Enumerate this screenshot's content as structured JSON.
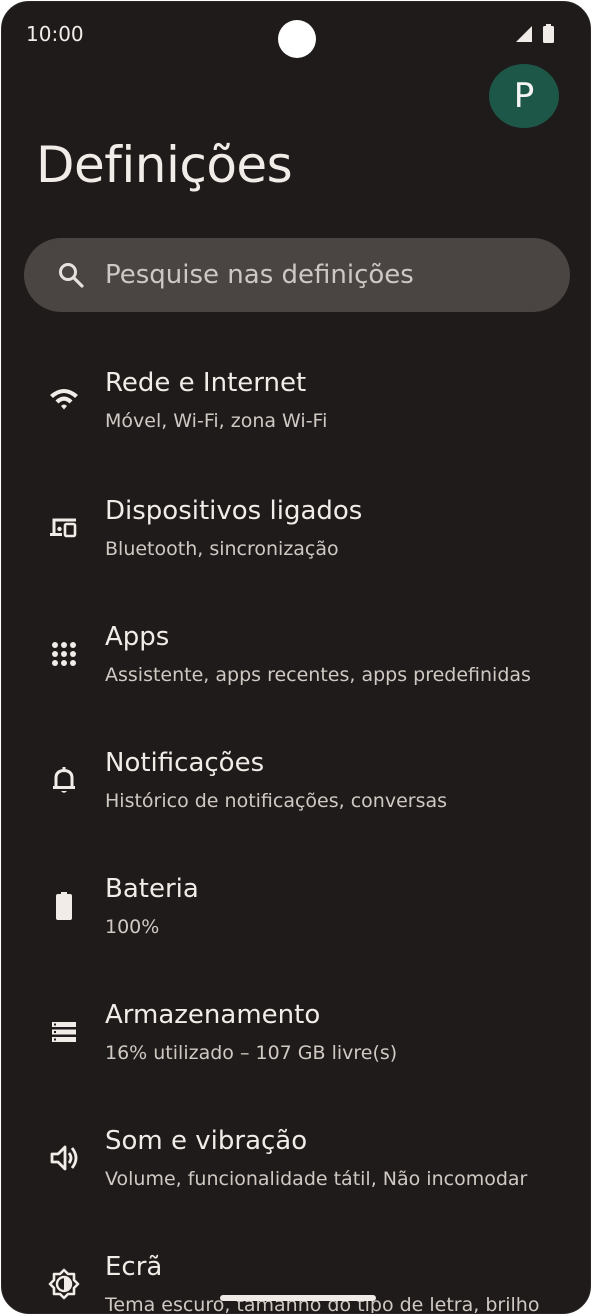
{
  "status_bar": {
    "time": "10:00"
  },
  "profile": {
    "initial": "P"
  },
  "page": {
    "title": "Definições"
  },
  "search": {
    "placeholder": "Pesquise nas definições"
  },
  "settings": [
    {
      "title": "Rede e Internet",
      "subtitle": "Móvel, Wi-Fi, zona Wi-Fi",
      "icon": "wifi-icon"
    },
    {
      "title": "Dispositivos ligados",
      "subtitle": "Bluetooth, sincronização",
      "icon": "connected-devices-icon"
    },
    {
      "title": "Apps",
      "subtitle": "Assistente, apps recentes, apps predefinidas",
      "icon": "apps-grid-icon"
    },
    {
      "title": "Notificações",
      "subtitle": "Histórico de notificações, conversas",
      "icon": "bell-icon"
    },
    {
      "title": "Bateria",
      "subtitle": "100%",
      "icon": "battery-icon"
    },
    {
      "title": "Armazenamento",
      "subtitle": "16% utilizado – 107 GB livre(s)",
      "icon": "storage-icon"
    },
    {
      "title": "Som e vibração",
      "subtitle": "Volume, funcionalidade tátil, Não incomodar",
      "icon": "volume-icon"
    },
    {
      "title": "Ecrã",
      "subtitle": "Tema escuro, tamanho do tipo de letra, brilho",
      "icon": "display-brightness-icon"
    }
  ],
  "colors": {
    "background": "#1f1b1a",
    "search_bg": "#4a4542",
    "avatar_bg": "#1d5748",
    "text_primary": "#f1ece8",
    "text_secondary": "#cfc8c3"
  }
}
